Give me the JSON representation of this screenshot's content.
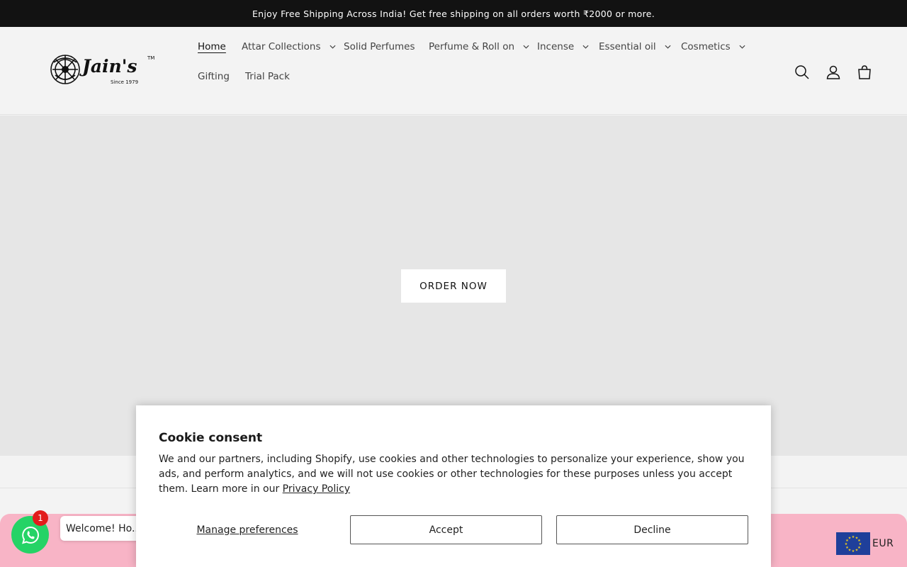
{
  "announcement": {
    "text": "Enjoy Free Shipping Across India! Get free shipping on all orders worth ₹2000 or more."
  },
  "header": {
    "logo_text": "Jain's",
    "logo_tagline": "Since 1979",
    "nav": [
      {
        "label": "Home",
        "active": true,
        "dropdown": false
      },
      {
        "label": "Attar Collections",
        "active": false,
        "dropdown": true
      },
      {
        "label": "Solid Perfumes",
        "active": false,
        "dropdown": false
      },
      {
        "label": "Perfume & Roll on",
        "active": false,
        "dropdown": true
      },
      {
        "label": "Incense",
        "active": false,
        "dropdown": true
      },
      {
        "label": "Essential oil",
        "active": false,
        "dropdown": true
      },
      {
        "label": "Cosmetics",
        "active": false,
        "dropdown": true
      },
      {
        "label": "Gifting",
        "active": false,
        "dropdown": false
      },
      {
        "label": "Trial Pack",
        "active": false,
        "dropdown": false
      }
    ],
    "icons": [
      "search-icon",
      "account-icon",
      "cart-icon"
    ]
  },
  "hero": {
    "button_label": "ORDER NOW"
  },
  "cookie": {
    "title": "Cookie consent",
    "body": "We and our partners, including Shopify, use cookies and other technologies to personalize your experience, show you ads, and perform analytics, and we will not use cookies or other technologies for these purposes unless you accept them. Learn more in our ",
    "link": "Privacy Policy",
    "manage_label": "Manage preferences",
    "accept_label": "Accept",
    "decline_label": "Decline"
  },
  "whatsapp": {
    "badge": "1",
    "bubble": "Welcome! Ho..."
  },
  "currency": {
    "code": "EUR"
  },
  "colors": {
    "announcement_bg": "#121212",
    "whatsapp": "#25d366",
    "pink_bar": "#f8b4c6",
    "eu_blue": "#1f3f9a",
    "eu_stars": "#f7d117"
  }
}
